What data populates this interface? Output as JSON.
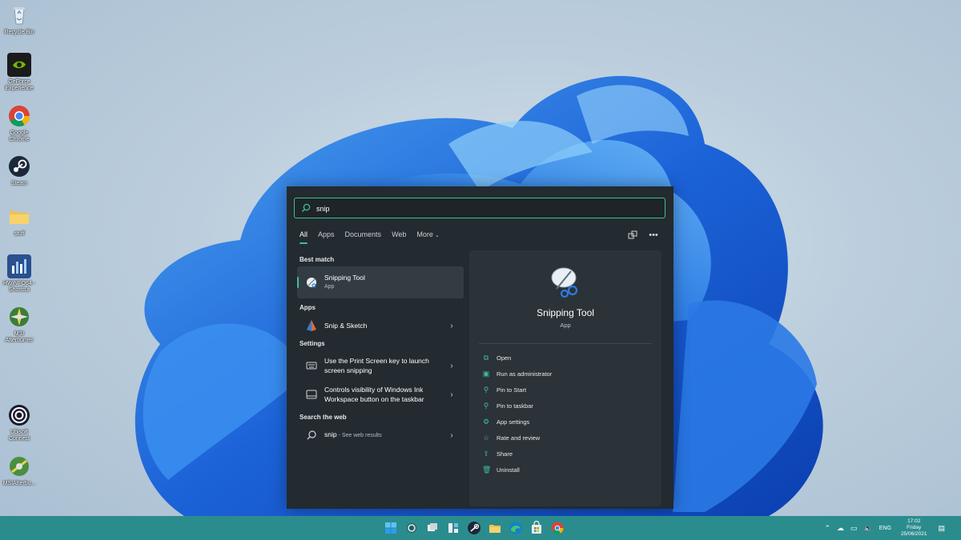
{
  "desktop": {
    "icons": [
      {
        "label": "Recycle Bin",
        "icon": "recycle-bin-icon"
      },
      {
        "label": "GeForce\nExperience",
        "icon": "geforce-experience-icon"
      },
      {
        "label": "Google\nChrome",
        "icon": "chrome-icon"
      },
      {
        "label": "Steam",
        "icon": "steam-icon"
      },
      {
        "label": "stuff",
        "icon": "folder-icon"
      },
      {
        "label": "HWiNFO64 -\nShortcut",
        "icon": "hwinfo-icon"
      },
      {
        "label": "MSI\nAfterburner",
        "icon": "msi-afterburner-icon"
      },
      {
        "label": "Ubisoft\nConnect",
        "icon": "ubisoft-connect-icon"
      },
      {
        "label": "MSIAfterbu...",
        "icon": "msi-afterburner-shortcut-icon"
      }
    ]
  },
  "search": {
    "value": "snip",
    "tabs": [
      "All",
      "Apps",
      "Documents",
      "Web",
      "More"
    ],
    "active_tab": "All"
  },
  "sections": {
    "best_match": "Best match",
    "apps": "Apps",
    "settings": "Settings",
    "web": "Search the web"
  },
  "results": {
    "best": {
      "title": "Snipping Tool",
      "type": "App"
    },
    "app_item": "Snip & Sketch",
    "setting1": "Use the Print Screen key to launch screen snipping",
    "setting2": "Controls visibility of Windows Ink Workspace button on the taskbar",
    "web_query": "snip",
    "web_suffix": " - See web results"
  },
  "detail": {
    "title": "Snipping Tool",
    "type": "App",
    "actions": [
      "Open",
      "Run as administrator",
      "Pin to Start",
      "Pin to taskbar",
      "App settings",
      "Rate and review",
      "Share",
      "Uninstall"
    ]
  },
  "taskbar": {
    "apps": [
      "start-icon",
      "search-icon",
      "task-view-icon",
      "widgets-icon",
      "steam-icon",
      "file-explorer-icon",
      "edge-icon",
      "store-icon",
      "chrome-icon"
    ],
    "language": "ENG",
    "time": "17:02",
    "day": "Friday",
    "date": "25/06/2021"
  },
  "colors": {
    "accent": "#3bbf9a",
    "panel": "#232a30",
    "taskbar": "#2b8c8e"
  }
}
